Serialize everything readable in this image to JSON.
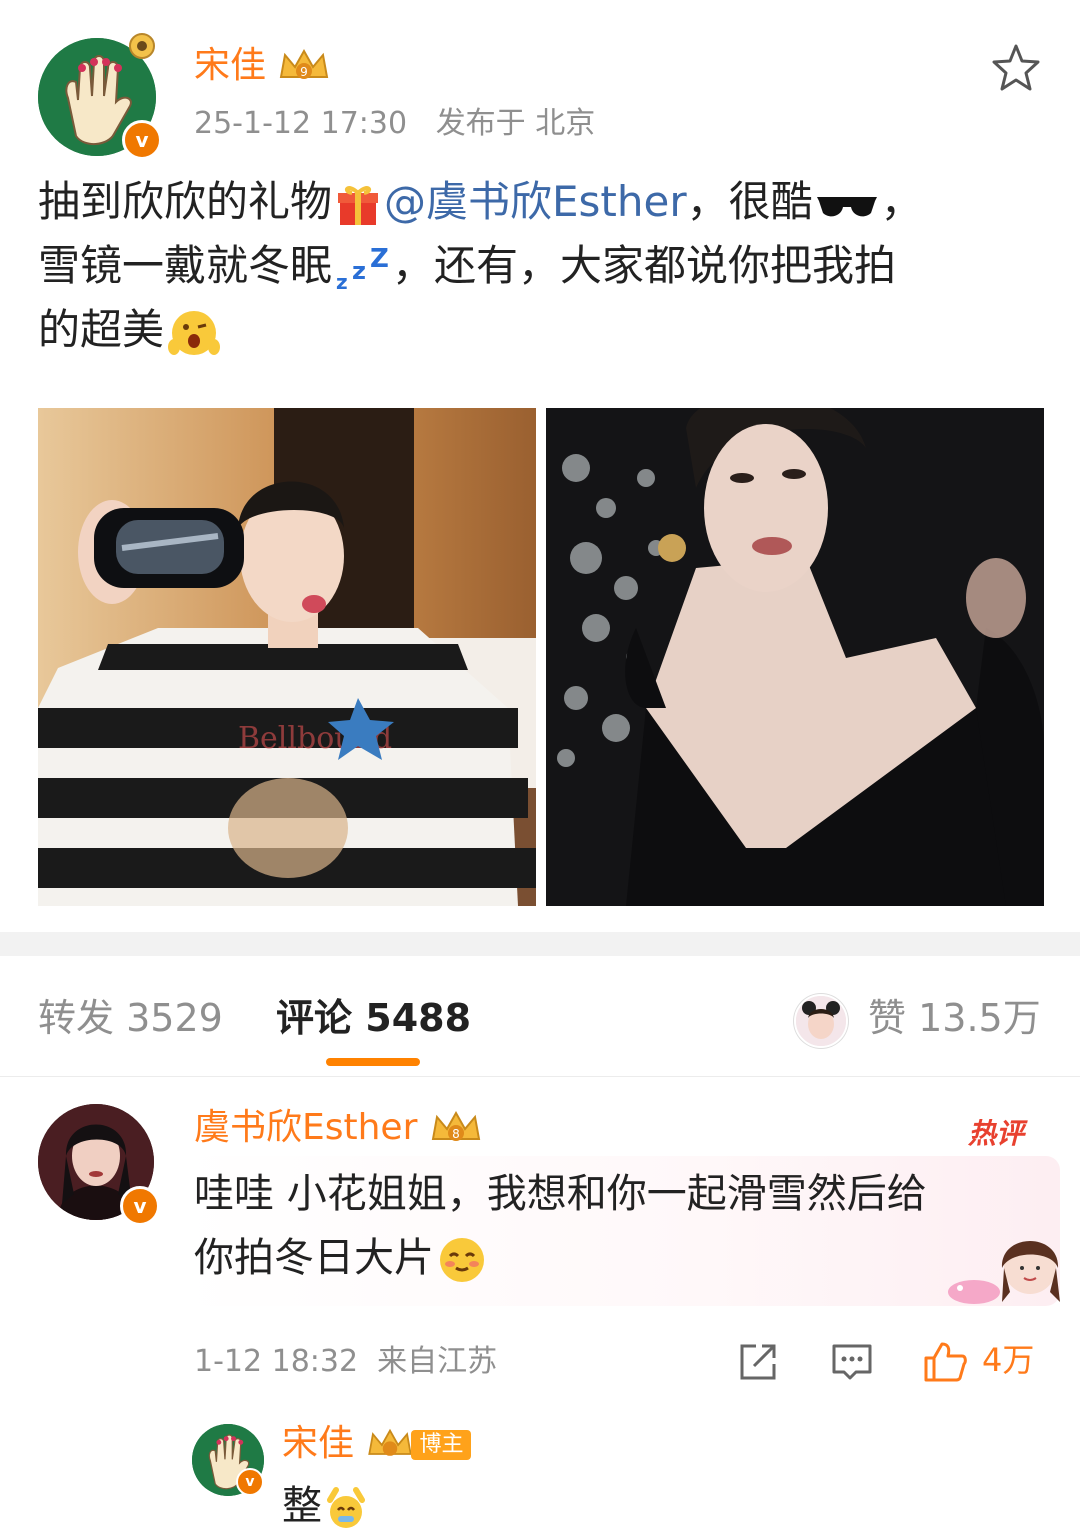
{
  "post": {
    "author": "宋佳",
    "time": "25-1-12 17:30",
    "location": "发布于 北京",
    "text_part1": "抽到欣欣的礼物",
    "mention": "@虞书欣Esther",
    "text_part2": "，很酷",
    "text_part3": "，",
    "text_line2": "雪镜一戴就冬眠",
    "text_part4": "，还有，大家都说你把我拍",
    "text_line3": "的超美",
    "icons": [
      "gift-emoji",
      "sunglasses-emoji",
      "zzz-emoji",
      "wink-emoji"
    ]
  },
  "stats": {
    "repost_label": "转发",
    "repost_count": "3529",
    "comment_label": "评论",
    "comment_count": "5488",
    "like_label": "赞",
    "like_count": "13.5万"
  },
  "comment": {
    "author": "虞书欣Esther",
    "hot_label": "热评",
    "text_line1": "哇哇 小花姐姐，我想和你一起滑雪然后给",
    "text_line2": "你拍冬日大片",
    "time": "1-12 18:32",
    "location": "来自江苏",
    "likes": "4万"
  },
  "reply": {
    "author": "宋佳",
    "badge": "博主",
    "text": "整"
  },
  "colors": {
    "accent": "#ff7a1a",
    "mention": "#3d69a8",
    "verified": "#f07800",
    "hot": "#e8412f"
  }
}
